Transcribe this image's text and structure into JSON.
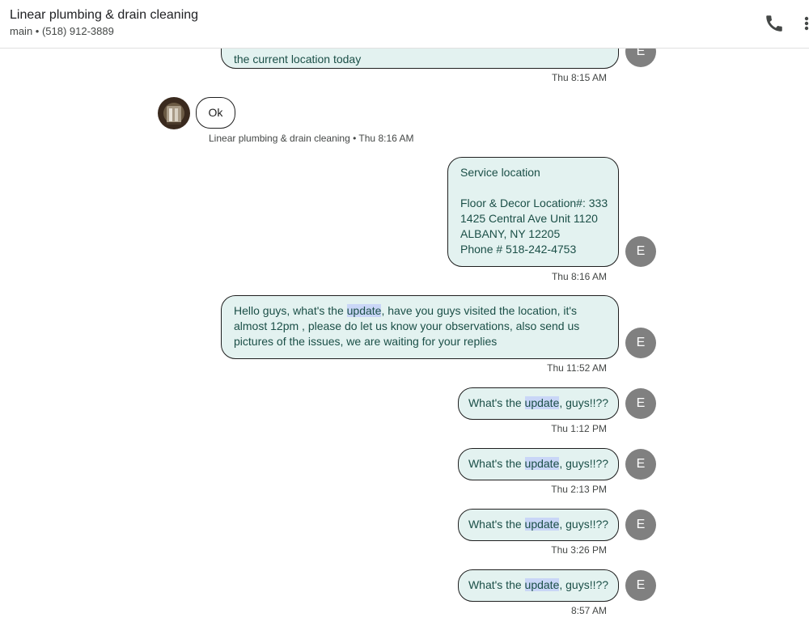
{
  "header": {
    "title": "Linear plumbing & drain cleaning",
    "subtitle": "main • (518) 912-3889",
    "call_icon": "phone-icon",
    "more_icon": "more-vert-icon"
  },
  "thread": {
    "avatar_initial": "E",
    "messages": [
      {
        "lines": [
          "the current location today"
        ],
        "time": "Thu 8:15 AM"
      },
      {
        "text": "Ok",
        "meta": "Linear plumbing & drain cleaning • Thu 8:16 AM"
      },
      {
        "lines": [
          "Service location",
          "",
          "Floor & Decor Location#: 333",
          "1425 Central Ave Unit 1120",
          "ALBANY, NY 12205",
          "Phone # 518-242-4753"
        ],
        "time": "Thu 8:16 AM"
      },
      {
        "line1_before": "Hello guys, what's the ",
        "line1_highlight": "update",
        "line1_after": ", have you guys visited the location, it's",
        "line2": "almost 12pm , please do let us know your observations, also send us",
        "line3": "pictures of the issues, we are waiting for your replies",
        "time": "Thu 11:52 AM"
      },
      {
        "before": "What's the ",
        "highlight": "update",
        "after": ", guys!!??",
        "time": "Thu 1:12 PM"
      },
      {
        "before": "What's the ",
        "highlight": "update",
        "after": ", guys!!??",
        "time": "Thu 2:13 PM"
      },
      {
        "before": "What's the ",
        "highlight": "update",
        "after": ", guys!!??",
        "time": "Thu 3:26 PM"
      },
      {
        "before": "What's the ",
        "highlight": "update",
        "after": ", guys!!??",
        "time": "8:57 AM"
      }
    ]
  }
}
